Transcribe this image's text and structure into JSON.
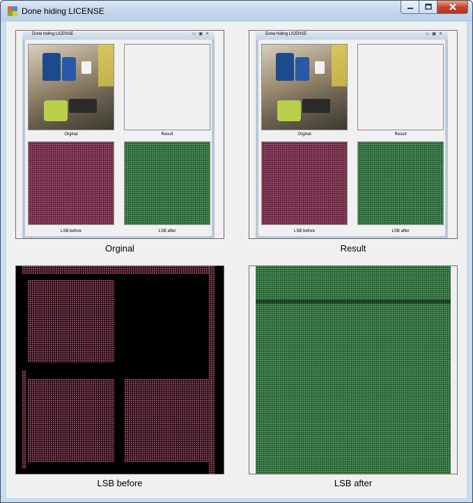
{
  "window": {
    "title": "Done hiding LICENSE",
    "controls": {
      "minimize": "minimize",
      "maximize": "maximize",
      "close": "close"
    }
  },
  "panels": [
    {
      "caption": "Orginal"
    },
    {
      "caption": "Result"
    },
    {
      "caption": "LSB before"
    },
    {
      "caption": "LSB after"
    }
  ],
  "nested_screenshot": {
    "title": "Done hiding LICENSE",
    "captions": [
      "Orginal",
      "Result",
      "LSB before",
      "LSB after"
    ]
  },
  "colors": {
    "lsb_before": "#6a2a44",
    "lsb_after": "#2f6a3c",
    "window_frame": "#c9dbee"
  },
  "icons": [
    "app-icon",
    "minimize-icon",
    "maximize-icon",
    "close-icon"
  ]
}
